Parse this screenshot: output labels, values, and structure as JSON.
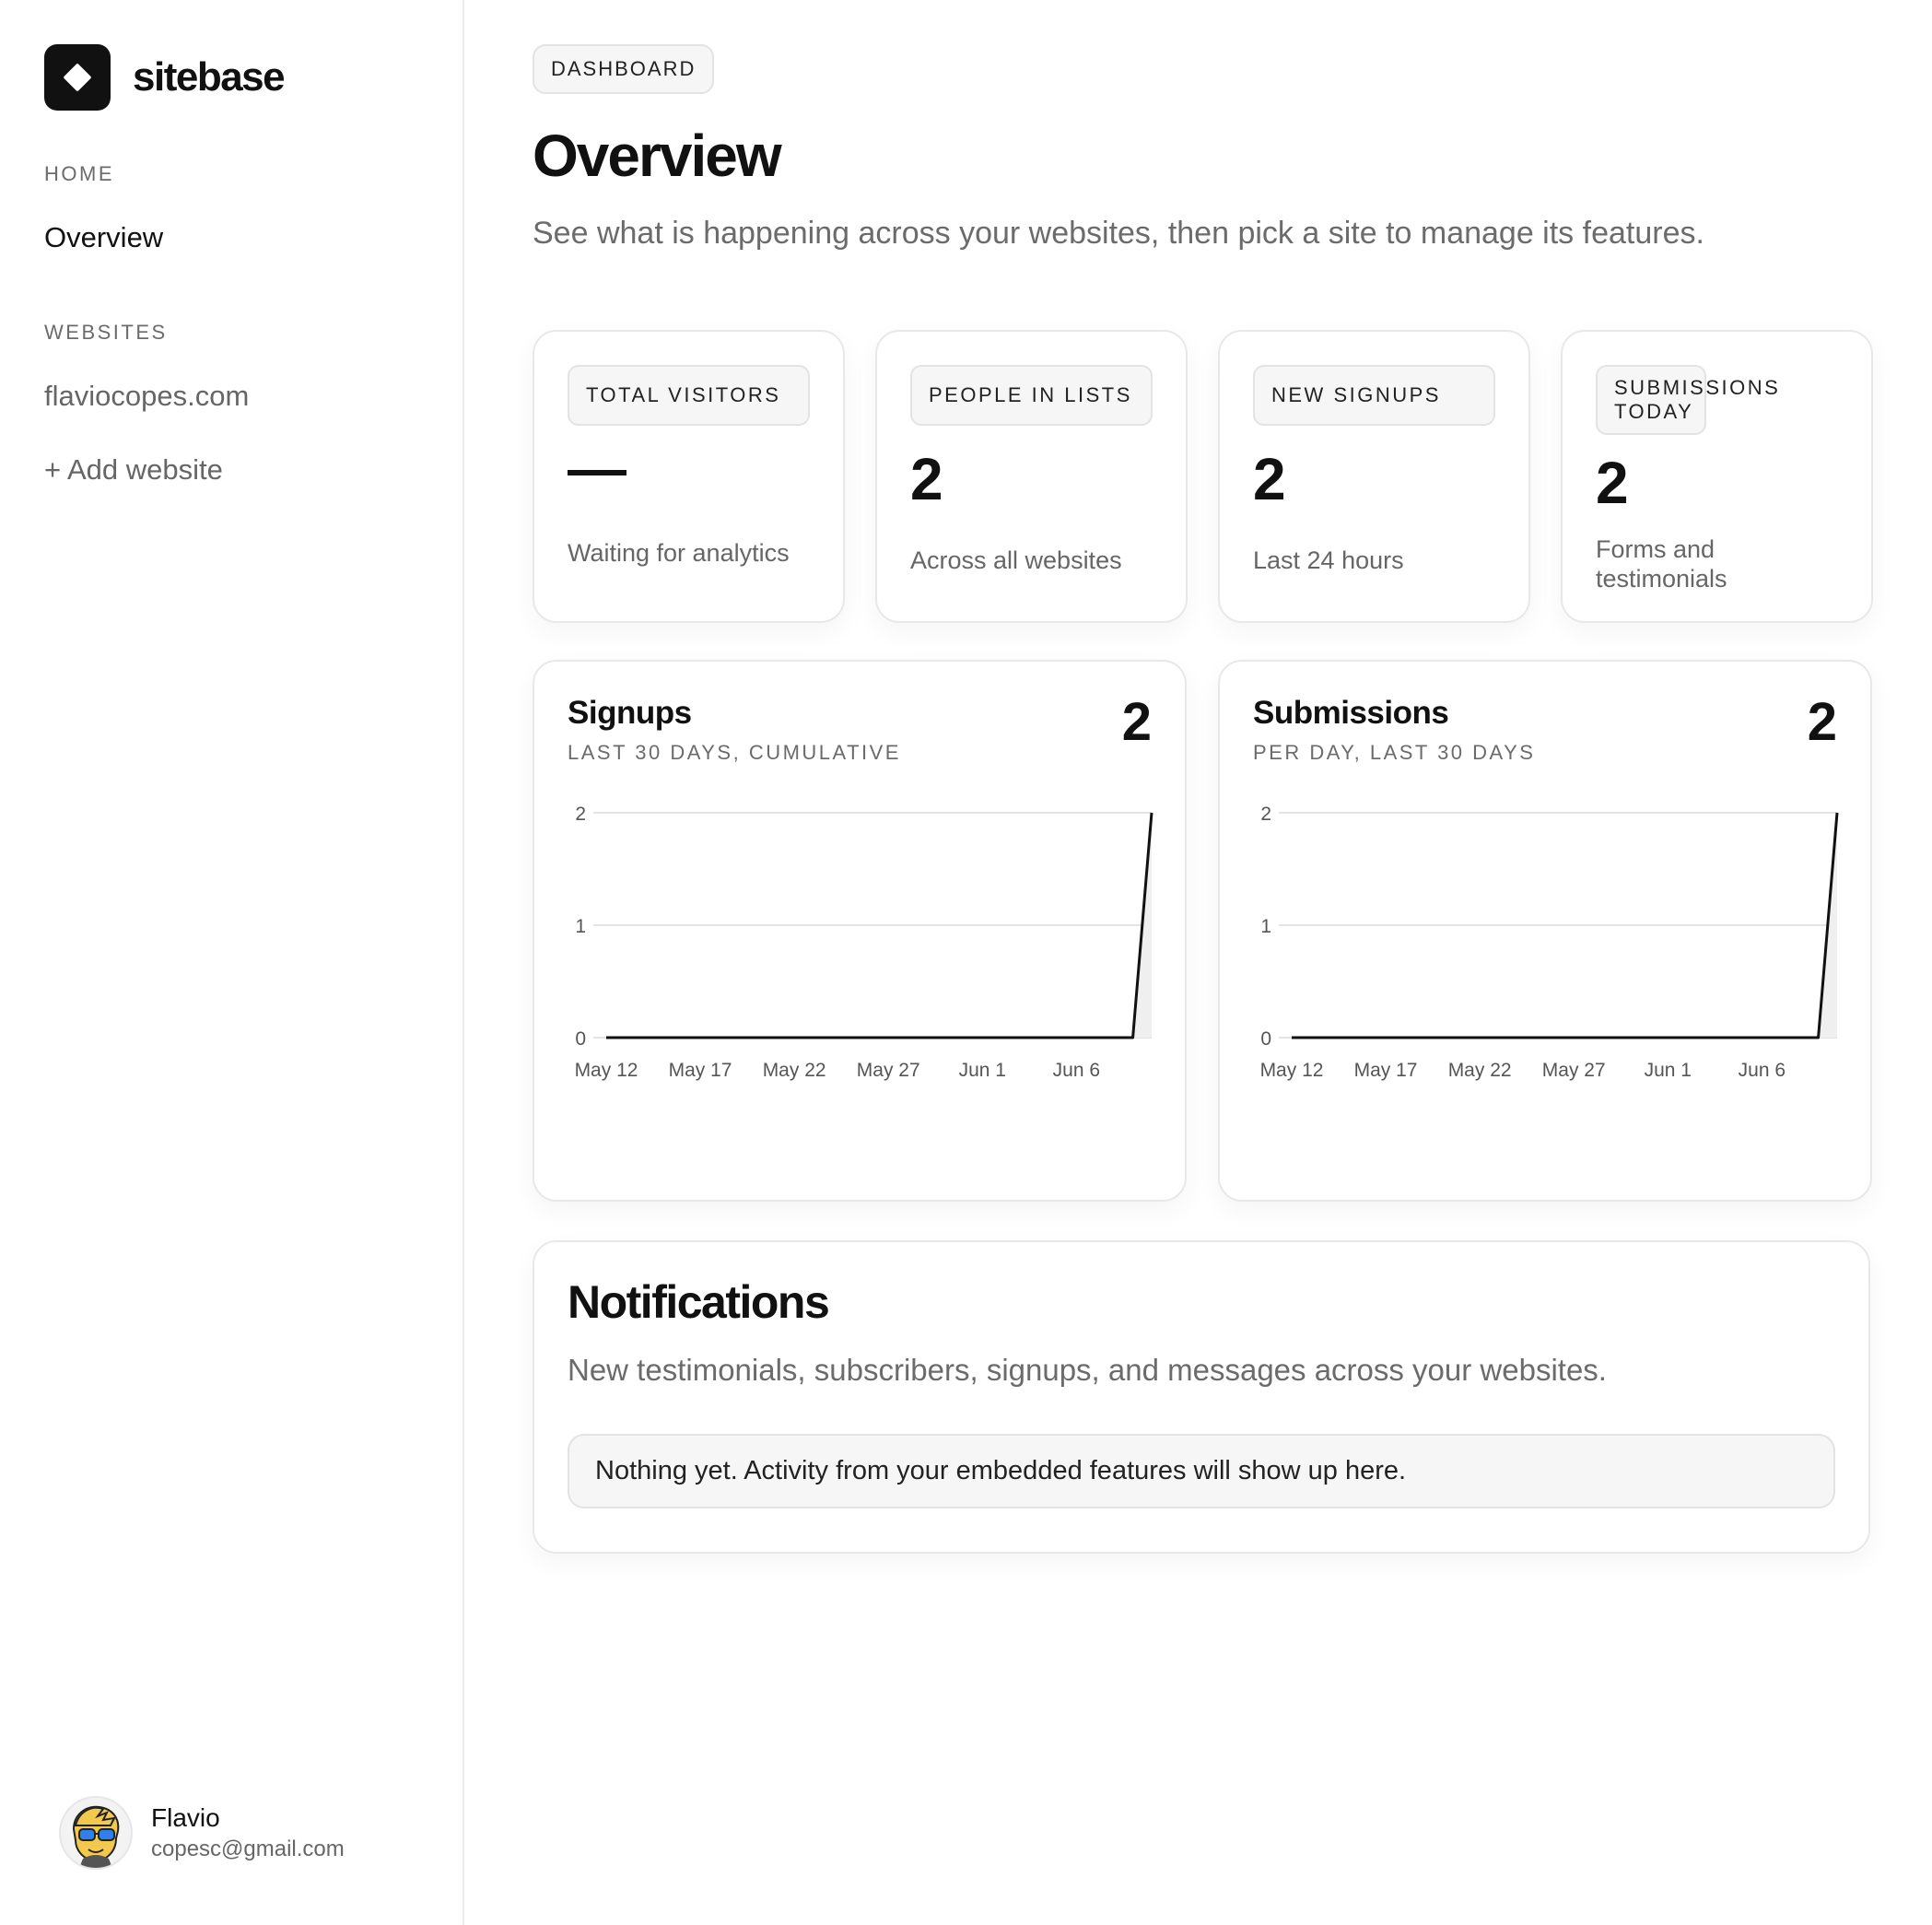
{
  "brand": {
    "name": "sitebase"
  },
  "sidebar": {
    "sections": [
      {
        "label": "HOME",
        "items": [
          {
            "label": "Overview"
          }
        ]
      },
      {
        "label": "WEBSITES",
        "items": [
          {
            "label": "flaviocopes.com"
          },
          {
            "label": "+ Add website"
          }
        ]
      }
    ],
    "user": {
      "name": "Flavio",
      "email": "copesc@gmail.com"
    }
  },
  "header": {
    "badge": "DASHBOARD",
    "title": "Overview",
    "subtitle": "See what is happening across your websites, then pick a site to manage its features."
  },
  "stats": [
    {
      "label": "TOTAL VISITORS",
      "value": "—",
      "sub": "Waiting for analytics"
    },
    {
      "label": "PEOPLE IN LISTS",
      "value": "2",
      "sub": "Across all websites"
    },
    {
      "label": "NEW SIGNUPS",
      "value": "2",
      "sub": "Last 24 hours"
    },
    {
      "label": "SUBMISSIONS TODAY",
      "value": "2",
      "sub": "Forms and testimonials"
    }
  ],
  "chart_data": [
    {
      "type": "area",
      "title": "Signups",
      "subtitle": "LAST 30 DAYS, CUMULATIVE",
      "total": "2",
      "x": [
        "May 12",
        "May 13",
        "May 14",
        "May 15",
        "May 16",
        "May 17",
        "May 18",
        "May 19",
        "May 20",
        "May 21",
        "May 22",
        "May 23",
        "May 24",
        "May 25",
        "May 26",
        "May 27",
        "May 28",
        "May 29",
        "May 30",
        "May 31",
        "Jun 1",
        "Jun 2",
        "Jun 3",
        "Jun 4",
        "Jun 5",
        "Jun 6",
        "Jun 7",
        "Jun 8",
        "Jun 9",
        "Jun 10"
      ],
      "values": [
        0,
        0,
        0,
        0,
        0,
        0,
        0,
        0,
        0,
        0,
        0,
        0,
        0,
        0,
        0,
        0,
        0,
        0,
        0,
        0,
        0,
        0,
        0,
        0,
        0,
        0,
        0,
        0,
        0,
        2
      ],
      "xticks": [
        "May 12",
        "May 17",
        "May 22",
        "May 27",
        "Jun 1",
        "Jun 6"
      ],
      "yticks": [
        "0",
        "1",
        "2"
      ],
      "ylim": [
        0,
        2
      ],
      "grid": true
    },
    {
      "type": "area",
      "title": "Submissions",
      "subtitle": "PER DAY, LAST 30 DAYS",
      "total": "2",
      "x": [
        "May 12",
        "May 13",
        "May 14",
        "May 15",
        "May 16",
        "May 17",
        "May 18",
        "May 19",
        "May 20",
        "May 21",
        "May 22",
        "May 23",
        "May 24",
        "May 25",
        "May 26",
        "May 27",
        "May 28",
        "May 29",
        "May 30",
        "May 31",
        "Jun 1",
        "Jun 2",
        "Jun 3",
        "Jun 4",
        "Jun 5",
        "Jun 6",
        "Jun 7",
        "Jun 8",
        "Jun 9",
        "Jun 10"
      ],
      "values": [
        0,
        0,
        0,
        0,
        0,
        0,
        0,
        0,
        0,
        0,
        0,
        0,
        0,
        0,
        0,
        0,
        0,
        0,
        0,
        0,
        0,
        0,
        0,
        0,
        0,
        0,
        0,
        0,
        0,
        2
      ],
      "xticks": [
        "May 12",
        "May 17",
        "May 22",
        "May 27",
        "Jun 1",
        "Jun 6"
      ],
      "yticks": [
        "0",
        "1",
        "2"
      ],
      "ylim": [
        0,
        2
      ],
      "grid": true
    }
  ],
  "notifications": {
    "title": "Notifications",
    "subtitle": "New testimonials, subscribers, signups, and messages across your websites.",
    "empty": "Nothing yet. Activity from your embedded features will show up here."
  },
  "colors": {
    "accent": "#111111",
    "muted_text": "#6b6b6b",
    "border": "#e8e8e8",
    "chip_bg": "#f6f6f6"
  }
}
